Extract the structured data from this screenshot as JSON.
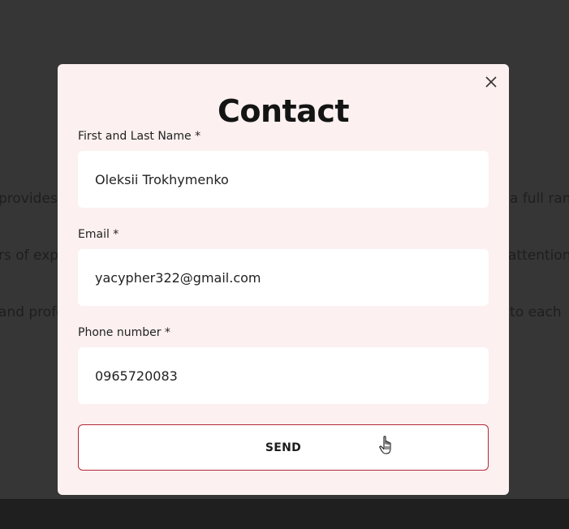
{
  "background": {
    "text_left": [
      "provides",
      "rs of exp",
      "and profe"
    ],
    "text_right": [
      "a full ran",
      "attention",
      "h to each"
    ]
  },
  "modal": {
    "title": "Contact",
    "close_icon": "close-icon",
    "fields": {
      "name": {
        "label": "First and Last Name *",
        "value": "Oleksii Trokhymenko"
      },
      "email": {
        "label": "Email *",
        "value": "yacypher322@gmail.com"
      },
      "phone": {
        "label": "Phone number *",
        "value": "0965720083"
      }
    },
    "send_label": "SEND"
  },
  "colors": {
    "modal_bg": "#fcf0f0",
    "accent_border": "#b4283a",
    "overlay": "#363636"
  },
  "cursor_icon": "hand-pointer-icon"
}
